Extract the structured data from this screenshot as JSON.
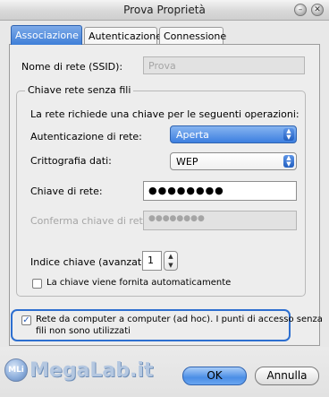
{
  "window": {
    "title": "Prova Proprietà"
  },
  "titlebar_buttons": {
    "minimize": "–",
    "close": "✕"
  },
  "tabs": [
    {
      "label": "Associazione",
      "active": true
    },
    {
      "label": "Autenticazione",
      "active": false
    },
    {
      "label": "Connessione",
      "active": false
    }
  ],
  "ssid": {
    "label": "Nome di rete (SSID):",
    "value": "Prova"
  },
  "group": {
    "title": "Chiave rete senza fili",
    "description": "La rete richiede una chiave per le seguenti operazioni:",
    "auth": {
      "label": "Autenticazione di rete:",
      "value": "Aperta"
    },
    "encryption": {
      "label": "Crittografia dati:",
      "value": "WEP"
    },
    "network_key": {
      "label": "Chiave di rete:",
      "value": "●●●●●●●●"
    },
    "confirm_key": {
      "label": "Conferma chiave di rete:",
      "value": "●●●●●●●●"
    },
    "key_index": {
      "label": "Indice chiave (avanzato):",
      "value": "1"
    },
    "auto_key": {
      "label": "La chiave viene fornita automaticamente",
      "checked": false
    }
  },
  "adhoc": {
    "line1": "Rete da computer a computer (ad hoc). I punti di accesso senza",
    "line2": "fili non sono utilizzati",
    "checked": true
  },
  "watermark": {
    "text": "MegaLab.it",
    "badge": "MLi"
  },
  "buttons": {
    "ok": "OK",
    "cancel": "Annulla"
  },
  "colors": {
    "accent": "#3e7fd8",
    "highlight_border": "#2d6fd0"
  }
}
